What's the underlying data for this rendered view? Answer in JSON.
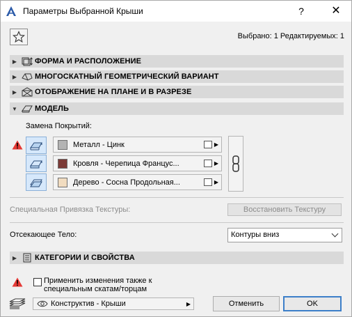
{
  "window": {
    "title": "Параметры Выбранной Крыши",
    "help": "?",
    "close": "✕"
  },
  "selection_info": "Выбрано: 1 Редактируемых: 1",
  "sections": [
    {
      "label": "ФОРМА И РАСПОЛОЖЕНИЕ",
      "arrow": "▶"
    },
    {
      "label": "МНОГОСКАТНЫЙ ГЕОМЕТРИЧЕСКИЙ ВАРИАНТ",
      "arrow": "▶"
    },
    {
      "label": "ОТОБРАЖЕНИЕ НА ПЛАНЕ И В РАЗРЕЗЕ",
      "arrow": "▶"
    },
    {
      "label": "МОДЕЛЬ",
      "arrow": "▼"
    }
  ],
  "model": {
    "override_label": "Замена Покрытий:",
    "materials": [
      {
        "name": "Металл - Цинк",
        "color": "#b3b3b3"
      },
      {
        "name": "Кровля - Черепица Францус...",
        "color": "#7c3b37"
      },
      {
        "name": "Дерево - Сосна Продольная...",
        "color": "#f1dcc0"
      }
    ],
    "texture_label": "Специальная Привязка Текстуры:",
    "texture_button": "Восстановить Текстуру",
    "trim_label": "Отсекающее Тело:",
    "trim_value": "Контуры вниз"
  },
  "categories_section": {
    "label": "КАТЕГОРИИ И СВОЙСТВА",
    "arrow": "▶"
  },
  "footer": {
    "apply_checkbox_line1": "Применить изменения также к",
    "apply_checkbox_line2": "специальным скатам/торцам",
    "layer": "Конструктив - Крыши",
    "cancel": "Отменить",
    "ok": "OK"
  },
  "colors": {
    "section_bg": "#d9d9d9",
    "ok_border": "#3c7fc9",
    "warn": "#e53935"
  }
}
